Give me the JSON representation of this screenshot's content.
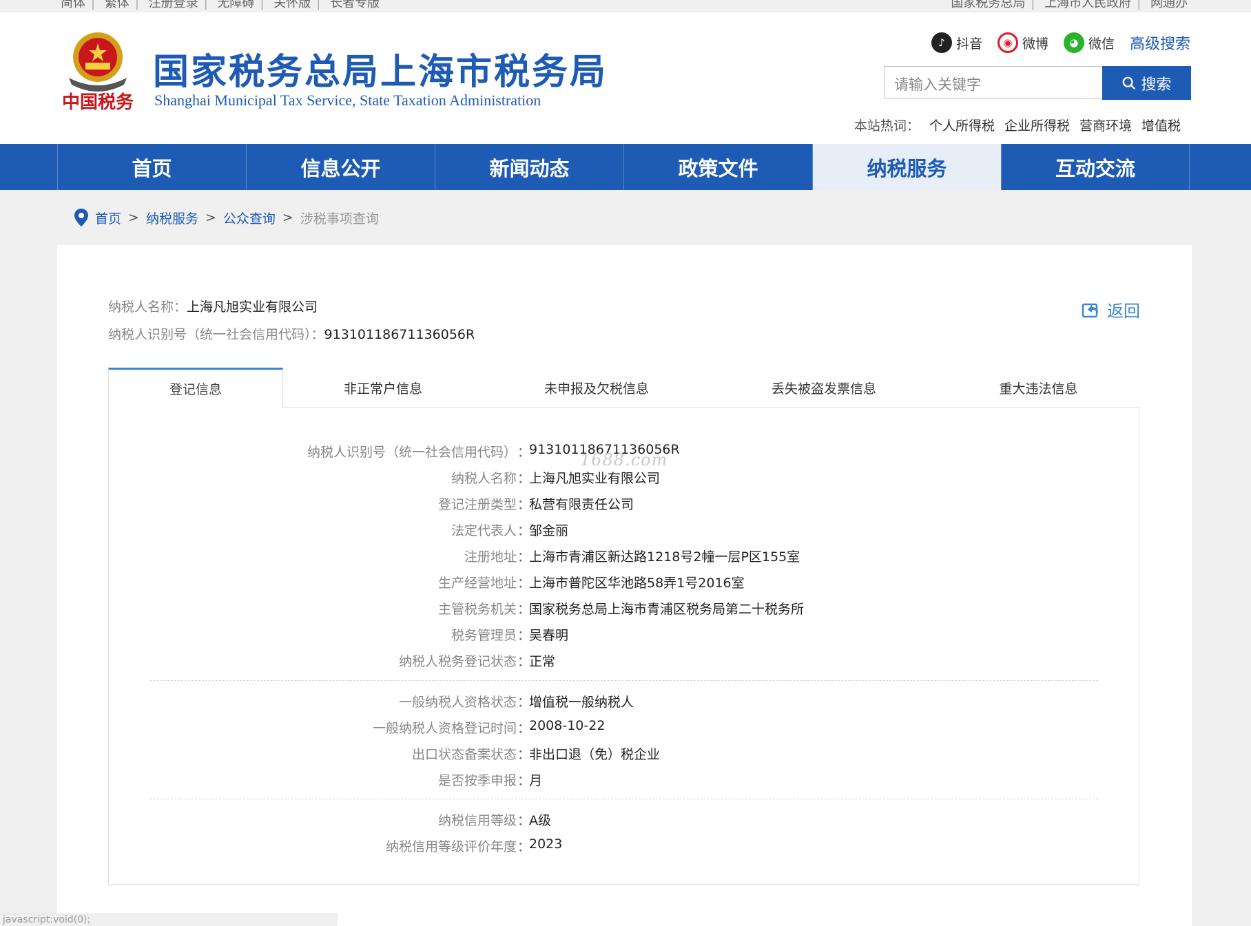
{
  "top_links": {
    "left": [
      "简体",
      "繁体",
      "注册登录",
      "无障碍",
      "关怀版",
      "长者专版"
    ],
    "right": [
      "国家税务总局",
      "上海市人民政府",
      "网通办"
    ]
  },
  "header": {
    "seal_text": "中国税务",
    "title_cn": "国家税务总局上海市税务局",
    "title_en": "Shanghai Municipal Tax Service, State Taxation Administration",
    "social": {
      "douyin": "抖音",
      "weibo": "微博",
      "wechat": "微信"
    },
    "advanced_search": "高级搜索",
    "search_placeholder": "请输入关键字",
    "search_button": "搜索",
    "hot_label": "本站热词：",
    "hot_words": [
      "个人所得税",
      "企业所得税",
      "营商环境",
      "增值税"
    ]
  },
  "nav": [
    "首页",
    "信息公开",
    "新闻动态",
    "政策文件",
    "纳税服务",
    "互动交流"
  ],
  "breadcrumb": [
    "首页",
    "纳税服务",
    "公众查询",
    "涉税事项查询"
  ],
  "taxpayer": {
    "name_label": "纳税人名称：",
    "name": "上海凡旭实业有限公司",
    "id_label": "纳税人识别号（统一社会信用代码）：",
    "id": "91310118671136056R"
  },
  "back_label": "返回",
  "tabs": [
    "登记信息",
    "非正常户信息",
    "未申报及欠税信息",
    "丢失被盗发票信息",
    "重大违法信息"
  ],
  "records": {
    "group1": [
      {
        "k": "纳税人识别号（统一社会信用代码）",
        "v": "91310118671136056R"
      },
      {
        "k": "纳税人名称",
        "v": "上海凡旭实业有限公司"
      },
      {
        "k": "登记注册类型",
        "v": "私营有限责任公司"
      },
      {
        "k": "法定代表人",
        "v": "邹金丽"
      },
      {
        "k": "注册地址",
        "v": "上海市青浦区新达路1218号2幢一层P区155室"
      },
      {
        "k": "生产经营地址",
        "v": "上海市普陀区华池路58弄1号2016室"
      },
      {
        "k": "主管税务机关",
        "v": "国家税务总局上海市青浦区税务局第二十税务所"
      },
      {
        "k": "税务管理员",
        "v": "吴春明"
      },
      {
        "k": "纳税人税务登记状态",
        "v": "正常"
      }
    ],
    "group2": [
      {
        "k": "一般纳税人资格状态",
        "v": "增值税一般纳税人"
      },
      {
        "k": "一般纳税人资格登记时间",
        "v": "2008-10-22"
      },
      {
        "k": "出口状态备案状态",
        "v": "非出口退（免）税企业"
      },
      {
        "k": "是否按季申报",
        "v": "月"
      }
    ],
    "group3": [
      {
        "k": "纳税信用等级",
        "v": "A级"
      },
      {
        "k": "纳税信用等级评价年度",
        "v": "2023"
      }
    ]
  },
  "watermark": "1688.com",
  "statusbar": "javascript:void(0);"
}
